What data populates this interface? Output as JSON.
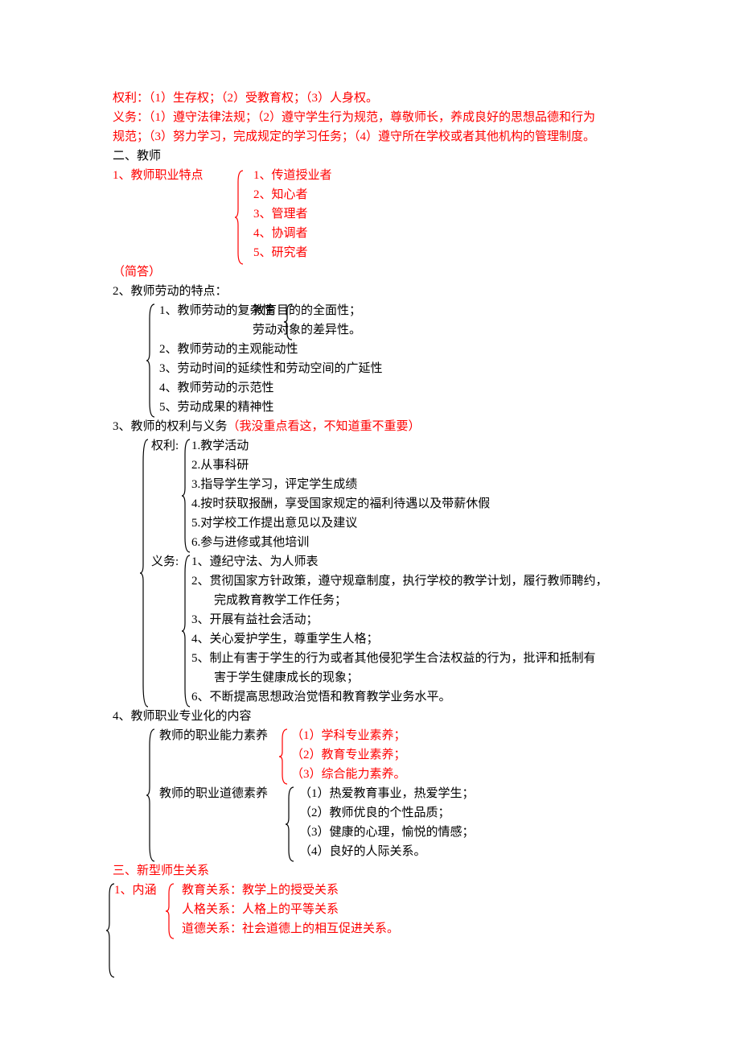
{
  "rights_title": "权利：（1）生存权；（2）受教育权；（3）人身权。",
  "duties_line1": "义务：（1）遵守法律法规；（2）遵守学生行为规范，尊敬师长，养成良好的思想品德和行为",
  "duties_line2": "规范；（3）努力学习，完成规定的学习任务；（4）遵守所在学校或者其他机构的管理制度。",
  "sec2_heading": "二、教师",
  "sec2_1_title": "1、教师职业特点",
  "sec2_1_items": {
    "i1": "1、传道授业者",
    "i2": "2、知心者",
    "i3": "3、管理者",
    "i4": "4、协调者",
    "i5": "5、研究者"
  },
  "simple_answer_tag": "（简答）",
  "sec2_2_title": "2、教师劳动的特点：",
  "sec2_2_items": {
    "i1": "1、教师劳动的复杂性",
    "i1_sub1": "教育目的的全面性；",
    "i1_sub2": "劳动对象的差异性。",
    "i2": "2、教师劳动的主观能动性",
    "i3": "3、劳动时间的延续性和劳动空间的广延性",
    "i4": "4、教师劳动的示范性",
    "i5": "5、劳动成果的精神性"
  },
  "sec2_3_title_a": "3、教师的权利与义务",
  "sec2_3_title_b": "（我没重点看这，不知道重不重要）",
  "rights_label": "权利:",
  "duties_label": "义务:",
  "rights_list": {
    "r1": "1.教学活动",
    "r2": "2.从事科研",
    "r3": "3.指导学生学习，评定学生成绩",
    "r4": "4.按时获取报酬，享受国家规定的福利待遇以及带薪休假",
    "r5": "5.对学校工作提出意见以及建议",
    "r6": "6.参与进修或其他培训"
  },
  "duties_list": {
    "d1": "1、遵纪守法、为人师表",
    "d2a": "2、贯彻国家方针政策，遵守规章制度，执行学校的教学计划，履行教师聘约，",
    "d2b": "完成教育教学工作任务；",
    "d3": "3、开展有益社会活动；",
    "d4": "4、关心爱护学生，尊重学生人格；",
    "d5a": "5、制止有害于学生的行为或者其他侵犯学生合法权益的行为，批评和抵制有",
    "d5b": "害于学生健康成长的现象；",
    "d6": "6、不断提高思想政治觉悟和教育教学业务水平。"
  },
  "sec2_4_title": "4、教师职业专业化的内容",
  "sec2_4_group1_label": "教师的职业能力素养",
  "sec2_4_group1_items": {
    "g1_1": "（1）学科专业素养；",
    "g1_2": "（2）教育专业素养；",
    "g1_3": "（3）综合能力素养。"
  },
  "sec2_4_group2_label": "教师的职业道德素养",
  "sec2_4_group2_items": {
    "g2_1": "（1）热爱教育事业，热爱学生；",
    "g2_2": "（2）教师优良的个性品质；",
    "g2_3": "（3）健康的心理，愉悦的情感；",
    "g2_4": "（4）良好的人际关系。"
  },
  "sec3_heading": "三、新型师生关系",
  "sec3_1_title": "1、内涵",
  "sec3_rel1": "教育关系：教学上的授受关系",
  "sec3_rel2": "人格关系：人格上的平等关系",
  "sec3_rel3": "道德关系：社会道德上的相互促进关系。"
}
